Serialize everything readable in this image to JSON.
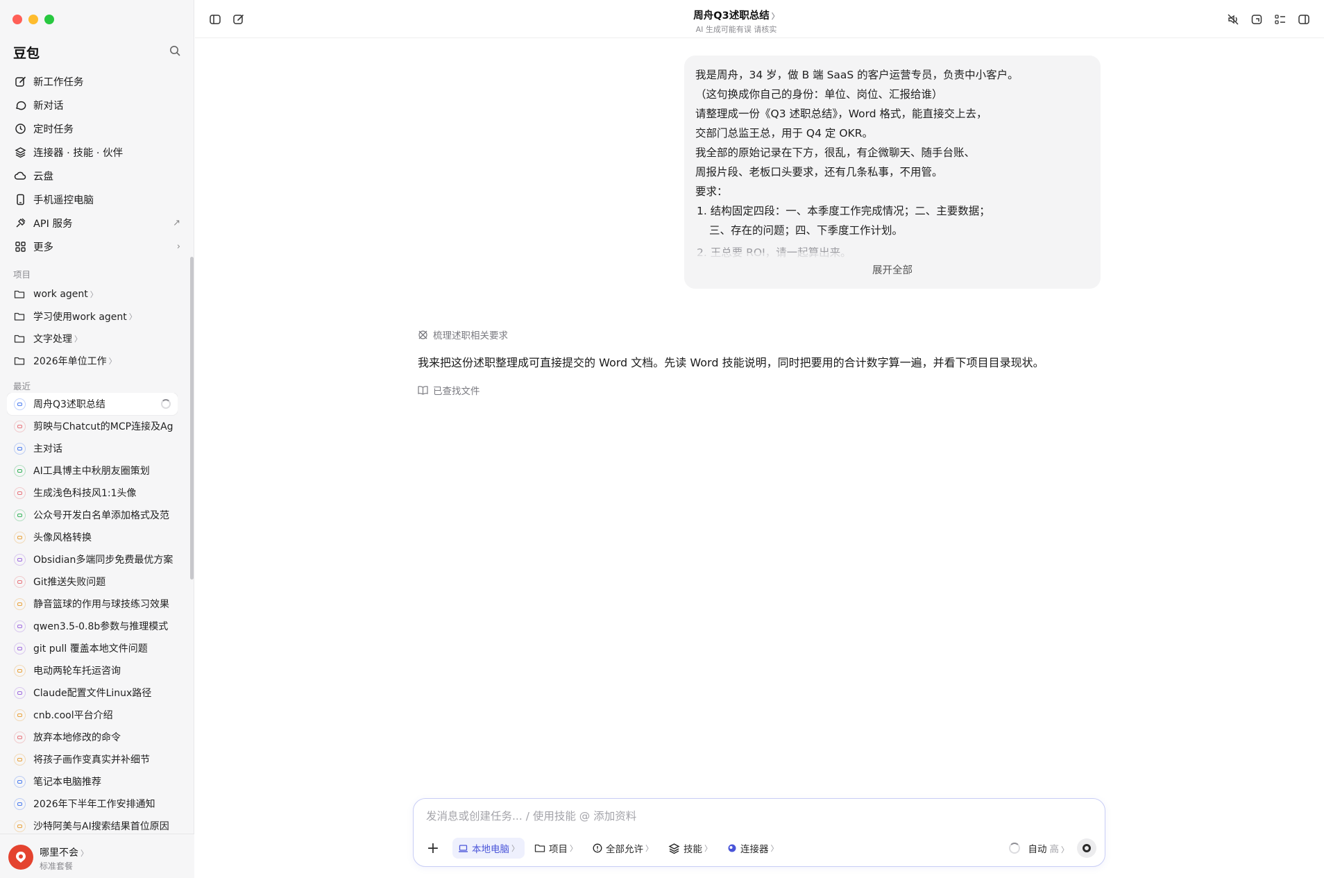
{
  "app": {
    "brand": "豆包"
  },
  "header": {
    "title": "周舟Q3述职总结",
    "subtitle": "AI 生成可能有误 请核实"
  },
  "nav": [
    {
      "label": "新工作任务",
      "icon": "edit-icon"
    },
    {
      "label": "新对话",
      "icon": "chat-bubble-icon"
    },
    {
      "label": "定时任务",
      "icon": "clock-icon"
    },
    {
      "label": "连接器 · 技能 · 伙伴",
      "icon": "layers-icon"
    },
    {
      "label": "云盘",
      "icon": "cloud-icon"
    },
    {
      "label": "手机遥控电脑",
      "icon": "phone-icon"
    },
    {
      "label": "API 服务",
      "icon": "plug-icon",
      "trail": "↗"
    },
    {
      "label": "更多",
      "icon": "grid-icon",
      "trail": "›"
    }
  ],
  "projects": {
    "label": "项目",
    "items": [
      "work agent",
      "学习使用work agent",
      "文字处理",
      "2026年单位工作"
    ]
  },
  "recent": {
    "label": "最近",
    "items": [
      {
        "label": "周舟Q3述职总结",
        "color": "#4a7cf0",
        "active": true
      },
      {
        "label": "剪映与Chatcut的MCP连接及Ag",
        "color": "#e8747c"
      },
      {
        "label": "主对话",
        "color": "#4a7cf0"
      },
      {
        "label": "AI工具博主中秋朋友圈策划",
        "color": "#34b35a"
      },
      {
        "label": "生成浅色科技风1:1头像",
        "color": "#e8747c"
      },
      {
        "label": "公众号开发白名单添加格式及范",
        "color": "#34b35a"
      },
      {
        "label": "头像风格转换",
        "color": "#e9a23b"
      },
      {
        "label": "Obsidian多端同步免费最优方案",
        "color": "#a06ce0"
      },
      {
        "label": "Git推送失败问题",
        "color": "#e8747c"
      },
      {
        "label": "静音篮球的作用与球技练习效果",
        "color": "#e9a23b"
      },
      {
        "label": "qwen3.5-0.8b参数与推理模式",
        "color": "#a06ce0"
      },
      {
        "label": "git pull 覆盖本地文件问题",
        "color": "#a06ce0"
      },
      {
        "label": "电动两轮车托运咨询",
        "color": "#e9a23b"
      },
      {
        "label": "Claude配置文件Linux路径",
        "color": "#a06ce0"
      },
      {
        "label": "cnb.cool平台介绍",
        "color": "#e9a23b"
      },
      {
        "label": "放弃本地修改的命令",
        "color": "#e8747c"
      },
      {
        "label": "将孩子画作变真实并补细节",
        "color": "#e9a23b"
      },
      {
        "label": "笔记本电脑推荐",
        "color": "#4a7cf0"
      },
      {
        "label": "2026年下半年工作安排通知",
        "color": "#4a7cf0"
      },
      {
        "label": "沙特阿美与AI搜索结果首位原因",
        "color": "#e9a23b"
      }
    ]
  },
  "user": {
    "name": "哪里不会",
    "plan": "标准套餐"
  },
  "message": {
    "lines": [
      "我是周舟，34 岁，做 B 端 SaaS 的客户运营专员，负责中小客户。",
      "（这句换成你自己的身份：单位、岗位、汇报给谁）",
      "请整理成一份《Q3 述职总结》，Word 格式，能直接交上去，",
      "交部门总监王总，用于 Q4 定 OKR。",
      "我全部的原始记录在下方，很乱，有企微聊天、随手台账、",
      "周报片段、老板口头要求，还有几条私事，不用管。",
      "要求："
    ],
    "list1a": "1. 结构固定四段：一、本季度工作完成情况；二、主要数据；",
    "list1b": "三、存在的问题；四、下季度工作计划。",
    "list2": "2. 王总要 ROI，请一起算出来。",
    "expand": "展开全部"
  },
  "ai": {
    "thought": "梳理述职相关要求",
    "answer": "我来把这份述职整理成可直接提交的 Word 文档。先读 Word 技能说明，同时把要用的合计数字算一遍，并看下项目目录现状。",
    "found": "已查找文件"
  },
  "composer": {
    "placeholder": "发消息或创建任务... / 使用技能 @ 添加资料",
    "tools": [
      {
        "label": "本地电脑",
        "icon": "laptop-icon",
        "selected": true
      },
      {
        "label": "项目",
        "icon": "folder-icon"
      },
      {
        "label": "全部允许",
        "icon": "alert-circle-icon"
      },
      {
        "label": "技能",
        "icon": "layers-icon"
      },
      {
        "label": "连接器",
        "icon": "connector-icon"
      }
    ],
    "mode": "自动",
    "level": "高"
  }
}
